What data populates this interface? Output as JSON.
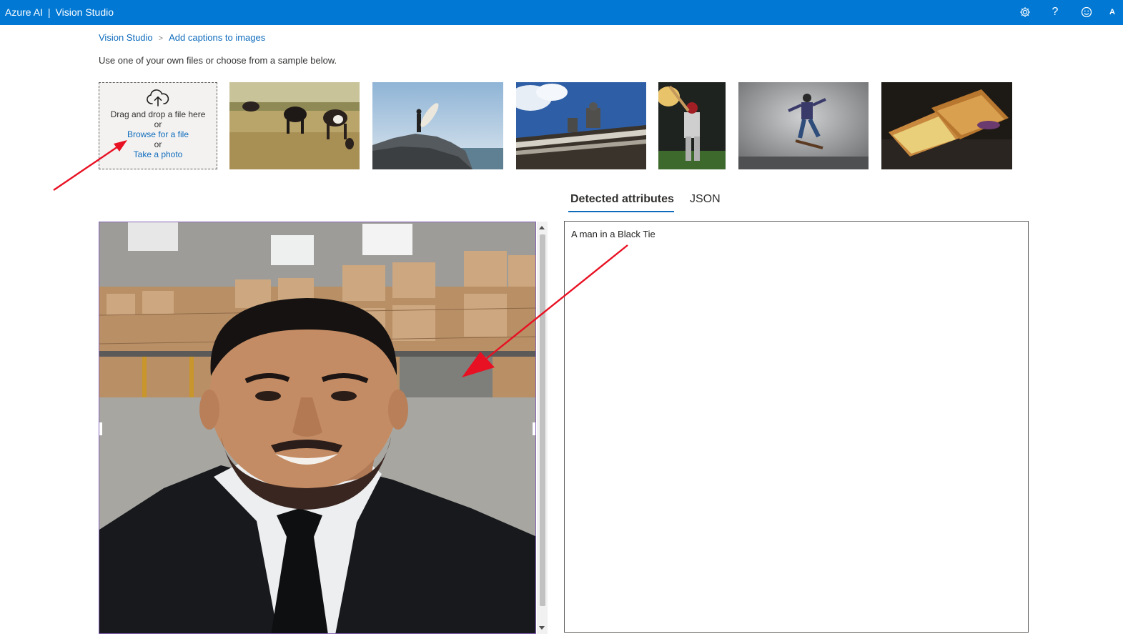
{
  "topbar": {
    "brand_left": "Azure AI",
    "brand_sep": "|",
    "brand_right": "Vision Studio",
    "icons": [
      "settings-icon",
      "help-icon",
      "feedback-icon"
    ],
    "avatar_initial": "A",
    "color": "#0078d4"
  },
  "breadcrumb": {
    "home": "Vision Studio",
    "separator": ">",
    "current": "Add captions to images"
  },
  "intro": "Use one of your own files or choose from a sample below.",
  "upload": {
    "drag_text": "Drag and drop a file here",
    "or1": "or",
    "browse": "Browse for a file",
    "or2": "or",
    "photo": "Take a photo"
  },
  "samples": [
    "cows-grazing",
    "surfer-on-cliff",
    "building-statues",
    "baseball-batter",
    "skateboarder",
    "grilled-sandwich"
  ],
  "tabs": {
    "detected": "Detected attributes",
    "json": "JSON"
  },
  "result": {
    "caption": "A man in a Black Tie"
  },
  "annotation_color": "#e81123"
}
